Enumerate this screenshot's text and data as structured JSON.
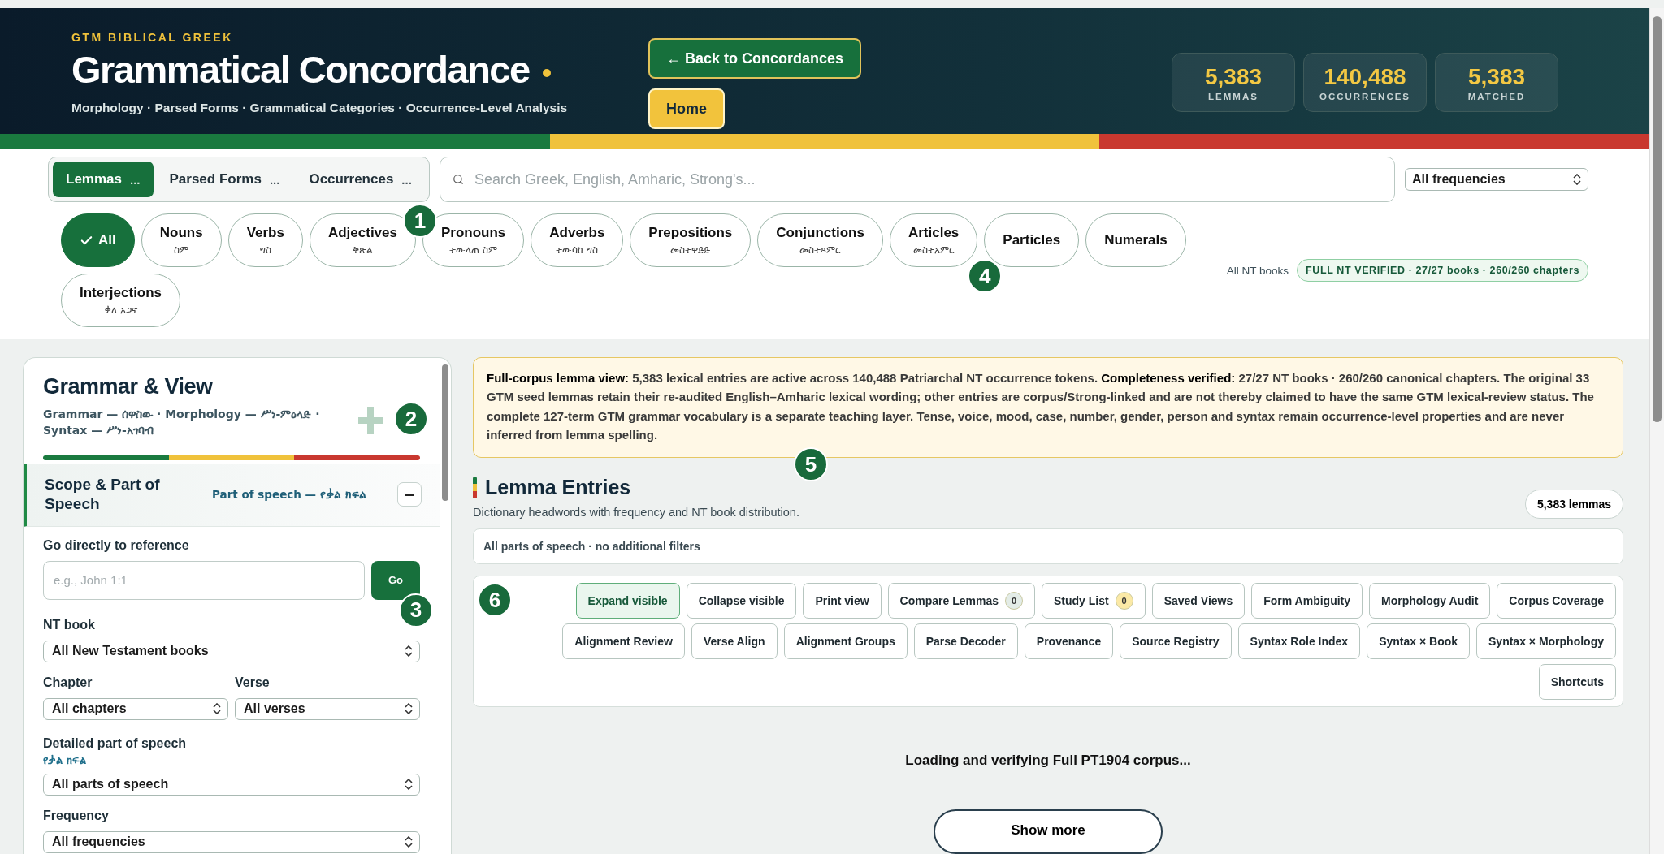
{
  "header": {
    "eyebrow": "GTM BIBLICAL GREEK",
    "title": "Grammatical Concordance",
    "subtitle": "Morphology · Parsed Forms · Grammatical Categories · Occurrence-Level Analysis",
    "buttons": [
      {
        "label": "← Back to Concordances",
        "kind": "back"
      },
      {
        "label": "Home",
        "kind": "home"
      }
    ],
    "stats": [
      {
        "value": "5,383",
        "label": "LEMMAS"
      },
      {
        "value": "140,488",
        "label": "OCCURRENCES"
      },
      {
        "value": "5,383",
        "label": "MATCHED"
      }
    ]
  },
  "view_tabs": [
    {
      "label": "Lemmas",
      "count": "...",
      "selected": true
    },
    {
      "label": "Parsed Forms",
      "count": "...",
      "selected": false
    },
    {
      "label": "Occurrences",
      "count": "...",
      "selected": false
    }
  ],
  "search": {
    "placeholder": "Search Greek, English, Amharic, Strong's..."
  },
  "frequency_select": {
    "value": "All frequencies"
  },
  "pos_chips": [
    {
      "label": "All",
      "selected": true
    },
    {
      "label": "Nouns",
      "amharic": "ስም",
      "selected": false
    },
    {
      "label": "Verbs",
      "amharic": "ግስ",
      "selected": false
    },
    {
      "label": "Adjectives",
      "amharic": "ቅጽል",
      "selected": false
    },
    {
      "label": "Pronouns",
      "amharic": "ተውላጠ ስም",
      "selected": false
    },
    {
      "label": "Adverbs",
      "amharic": "ተውሳከ ግስ",
      "selected": false
    },
    {
      "label": "Prepositions",
      "amharic": "መስተዋድድ",
      "selected": false
    },
    {
      "label": "Conjunctions",
      "amharic": "መስተጻምር",
      "selected": false
    },
    {
      "label": "Articles",
      "amharic": "መስተአምር",
      "selected": false
    },
    {
      "label": "Particles",
      "selected": false
    },
    {
      "label": "Numerals",
      "selected": false
    },
    {
      "label": "Interjections",
      "amharic": "ቃለ አጋኖ",
      "selected": false
    }
  ],
  "scope": {
    "label": "All NT books",
    "badge": "FULL NT VERIFIED · 27/27 books · 260/260 chapters"
  },
  "sidebar": {
    "title": "Grammar & View",
    "subtitle": "Grammar — ሰዋስው · Morphology — ሥነ-ምዕላድ · Syntax — ሥነ-አገባብ",
    "section": {
      "title": "Scope & Part of Speech",
      "subtitle": "Part of speech — የቃል ክፍል",
      "expanded": true
    },
    "reference": {
      "label": "Go directly to reference",
      "placeholder": "e.g., John 1:1",
      "button": "Go"
    },
    "nt_book": {
      "label": "NT book",
      "value": "All New Testament books"
    },
    "chapter": {
      "label": "Chapter",
      "value": "All chapters"
    },
    "verse": {
      "label": "Verse",
      "value": "All verses"
    },
    "detailed_pos": {
      "label": "Detailed part of speech",
      "sublabel": "የቃል ክፍል",
      "value": "All parts of speech"
    },
    "frequency": {
      "label": "Frequency",
      "value": "All frequencies"
    }
  },
  "notice": "**Full-corpus lemma view:** 5,383 lexical entries are active across 140,488 Patriarchal NT occurrence tokens. **Completeness verified:** 27/27 NT books · 260/260 canonical chapters. The original 33 GTM seed lemmas retain their re-audited English–Amharic lexical wording; other entries are corpus/Strong-linked and are not thereby claimed to have the same GTM lexical-review status. The complete 127-term GTM grammar vocabulary is a separate teaching layer. Tense, voice, mood, case, number, gender, person and syntax remain occurrence-level properties and are never inferred from lemma spelling.",
  "entries": {
    "title": "Lemma Entries",
    "subtitle": "Dictionary headwords with frequency and NT book distribution.",
    "count": "5,383 lemmas",
    "filter_summary": "All parts of speech · no additional filters",
    "tools": [
      {
        "label": "Expand visible",
        "selected": true
      },
      {
        "label": "Collapse visible",
        "selected": false
      },
      {
        "label": "Print view",
        "selected": false
      },
      {
        "label": "Compare Lemmas",
        "selected": false,
        "badge": "0",
        "color": "#e3ece7"
      },
      {
        "label": "Study List",
        "selected": false,
        "badge": "0",
        "color": "#fbe9a6"
      },
      {
        "label": "Saved Views",
        "selected": false
      },
      {
        "label": "Form Ambiguity",
        "selected": false
      },
      {
        "label": "Morphology Audit",
        "selected": false
      },
      {
        "label": "Corpus Coverage",
        "selected": false
      },
      {
        "label": "Alignment Review",
        "selected": false
      },
      {
        "label": "Verse Align",
        "selected": false
      },
      {
        "label": "Alignment Groups",
        "selected": false
      },
      {
        "label": "Parse Decoder",
        "selected": false
      },
      {
        "label": "Provenance",
        "selected": false
      },
      {
        "label": "Source Registry",
        "selected": false
      },
      {
        "label": "Syntax Role Index",
        "selected": false
      },
      {
        "label": "Syntax × Book",
        "selected": false
      },
      {
        "label": "Syntax × Morphology",
        "selected": false
      },
      {
        "label": "Shortcuts",
        "selected": false
      }
    ],
    "loading": "Loading and verifying Full PT1904 corpus...",
    "show_more": "Show more"
  },
  "markers": [
    {
      "label": "1"
    },
    {
      "label": "2"
    },
    {
      "label": "3"
    },
    {
      "label": "4"
    },
    {
      "label": "5"
    },
    {
      "label": "6"
    }
  ]
}
